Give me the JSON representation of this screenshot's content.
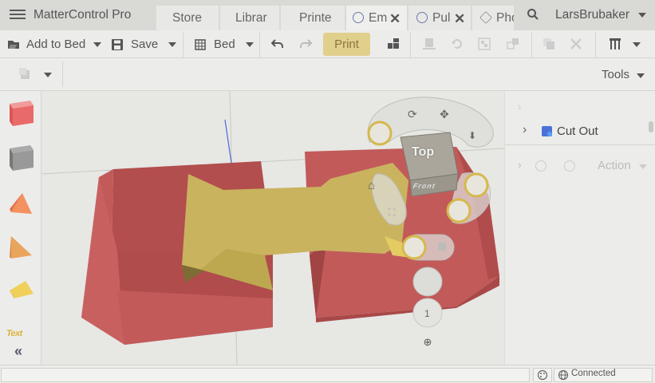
{
  "app": {
    "title": "MatterControl Pro"
  },
  "tabs": [
    {
      "label": "Store"
    },
    {
      "label": "Librar"
    },
    {
      "label": "Printe"
    },
    {
      "label": "Em"
    },
    {
      "label": "Pul"
    },
    {
      "label": "Pho"
    }
  ],
  "user": {
    "name": "LarsBrubaker"
  },
  "toolbar": {
    "add_to_bed": "Add to Bed",
    "save": "Save",
    "bed": "Bed",
    "print": "Print"
  },
  "subbar": {
    "tools": "Tools"
  },
  "shapes": {
    "text_label": "Text"
  },
  "view_cube": {
    "top": "Top",
    "front": "Front",
    "layer": "1"
  },
  "scene_tree": {
    "item": "Cut Out",
    "action": "Action"
  },
  "status": {
    "connection": "Connected"
  },
  "colors": {
    "accent": "#e1cf8c",
    "part_red": "#c95a5a",
    "part_gold": "#c9b35e"
  }
}
